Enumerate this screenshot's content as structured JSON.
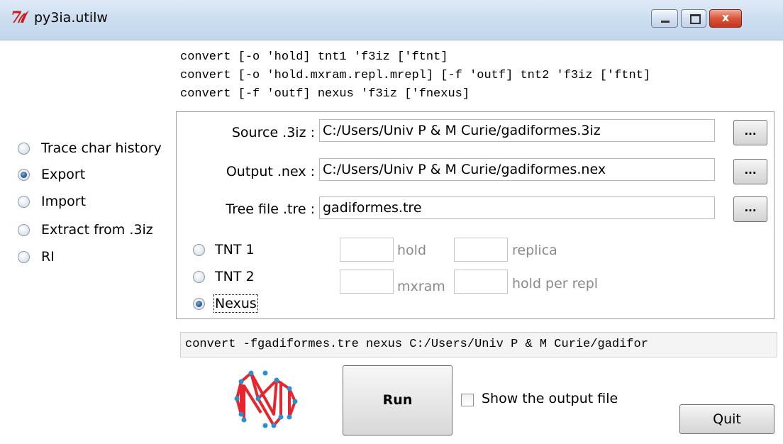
{
  "window": {
    "title": "py3ia.utilw",
    "close_glyph": "x"
  },
  "usage_lines": [
    "convert [-o 'hold] tnt1 'f3iz ['ftnt]",
    "convert [-o 'hold.mxram.repl.mrepl] [-f 'outf] tnt2 'f3iz ['ftnt]",
    "convert [-f 'outf] nexus 'f3iz ['fnexus]"
  ],
  "menu": {
    "items": [
      {
        "label": "Trace char history",
        "selected": false
      },
      {
        "label": "Export",
        "selected": true
      },
      {
        "label": "Import",
        "selected": false
      },
      {
        "label": "Extract from .3iz",
        "selected": false
      },
      {
        "label": "RI",
        "selected": false
      }
    ]
  },
  "files": {
    "source": {
      "label": "Source .3iz :",
      "value": "C:/Users/Univ P & M Curie/gadiformes.3iz"
    },
    "output": {
      "label": "Output .nex :",
      "value": "C:/Users/Univ P & M Curie/gadiformes.nex"
    },
    "tree": {
      "label": "Tree file .tre :",
      "value": "gadiformes.tre"
    },
    "browse_label": "..."
  },
  "formats": [
    {
      "label": "TNT 1",
      "selected": false
    },
    {
      "label": "TNT 2",
      "selected": false
    },
    {
      "label": "Nexus",
      "selected": true
    }
  ],
  "options": {
    "hold": "hold",
    "replica": "replica",
    "mxram": "mxram",
    "hold_per_repl": "hold per repl"
  },
  "command": "convert -fgadiformes.tre nexus C:/Users/Univ P & M Curie/gadifor",
  "run_label": "Run",
  "show_output": {
    "label": "Show the output file",
    "checked": false
  },
  "quit_label": "Quit",
  "colors": {
    "logo_red": "#e8242c",
    "logo_node": "#2a8fd0",
    "titlebar": "#cbdcef"
  }
}
